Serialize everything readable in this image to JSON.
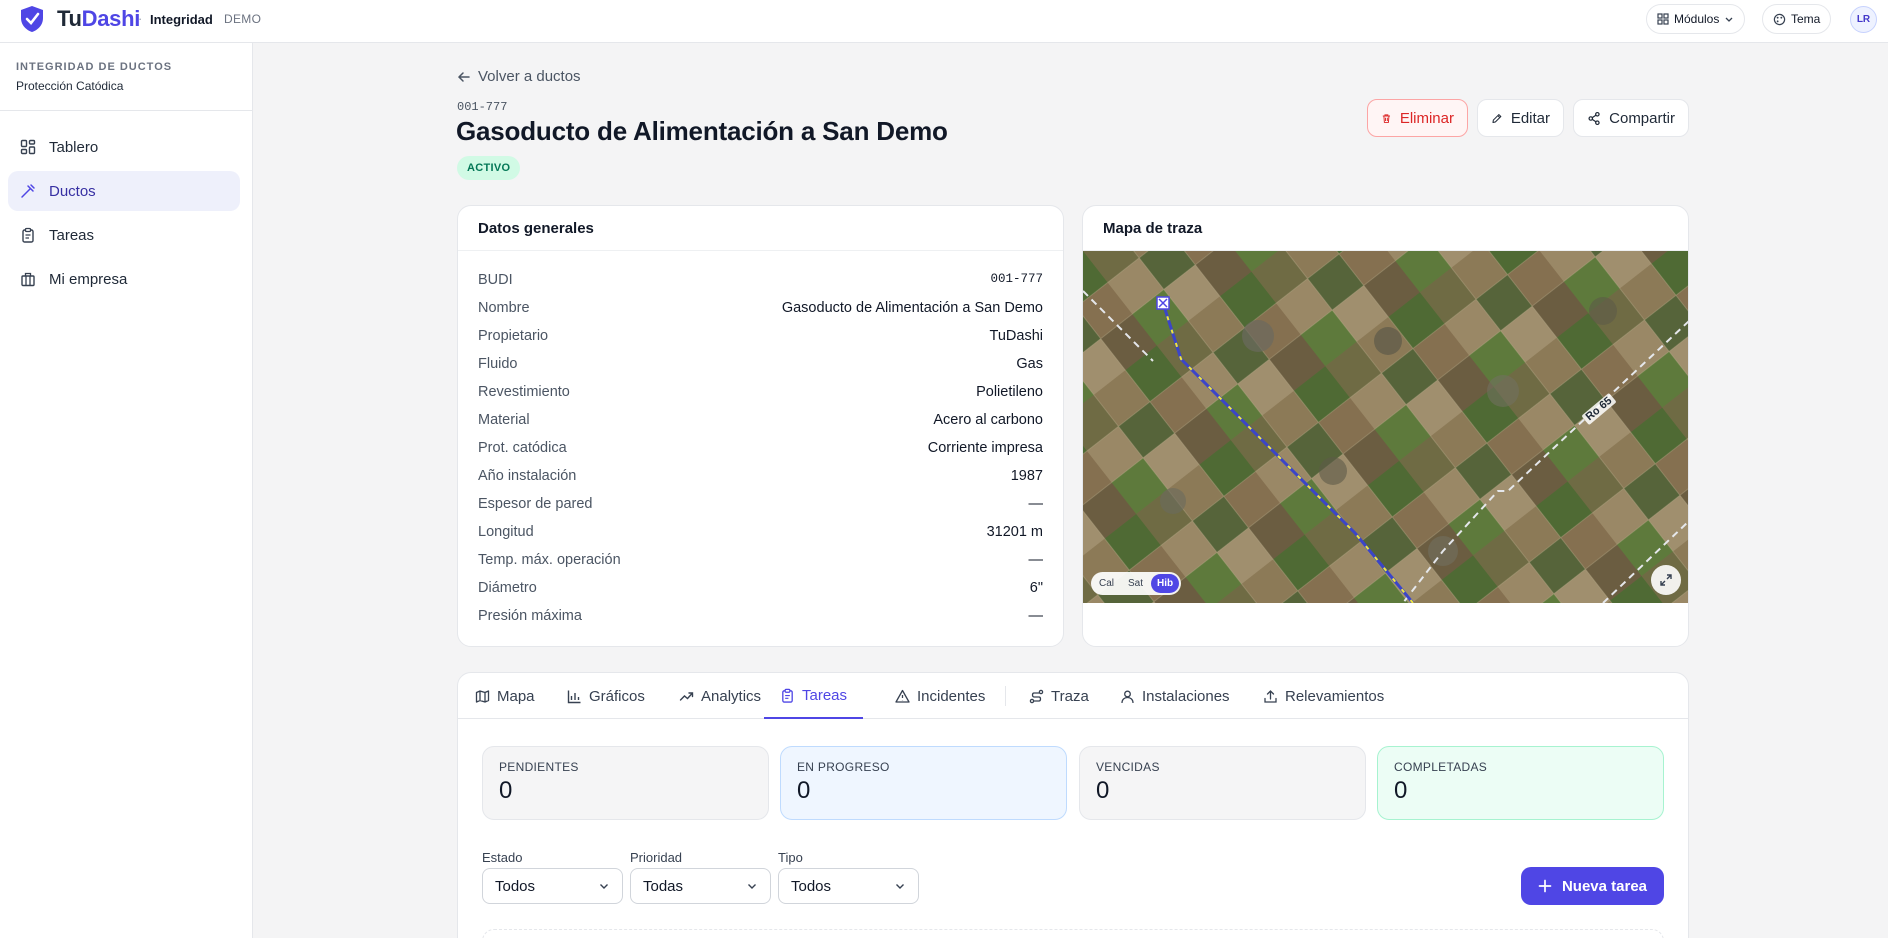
{
  "app": {
    "brand_tu": "Tu",
    "brand_dashi": "Dashi",
    "separator": "·",
    "module": "Integridad",
    "env": "DEMO",
    "modules_label": "Módulos",
    "theme_label": "Tema",
    "avatar_initials": "LR"
  },
  "sidebar": {
    "section_title": "INTEGRIDAD DE DUCTOS",
    "section_subtitle": "Protección Catódica",
    "items": [
      {
        "label": "Tablero",
        "icon": "dashboard-icon",
        "active": false
      },
      {
        "label": "Ductos",
        "icon": "pipe-icon",
        "active": true
      },
      {
        "label": "Tareas",
        "icon": "clipboard-icon",
        "active": false
      },
      {
        "label": "Mi empresa",
        "icon": "building-icon",
        "active": false
      }
    ]
  },
  "page": {
    "back_label": "Volver a ductos",
    "code": "001-777",
    "title": "Gasoducto de Alimentación a San Demo",
    "status": "ACTIVO",
    "actions": {
      "delete": "Eliminar",
      "edit": "Editar",
      "share": "Compartir"
    }
  },
  "general": {
    "title": "Datos generales",
    "rows": [
      {
        "key": "BUDI",
        "value": "001-777"
      },
      {
        "key": "Nombre",
        "value": "Gasoducto de Alimentación a San Demo"
      },
      {
        "key": "Propietario",
        "value": "TuDashi"
      },
      {
        "key": "Fluido",
        "value": "Gas"
      },
      {
        "key": "Revestimiento",
        "value": "Polietileno"
      },
      {
        "key": "Material",
        "value": "Acero al carbono"
      },
      {
        "key": "Prot. catódica",
        "value": "Corriente impresa"
      },
      {
        "key": "Año instalación",
        "value": "1987"
      },
      {
        "key": "Espesor de pared",
        "value": "—"
      },
      {
        "key": "Longitud",
        "value": "31201 m"
      },
      {
        "key": "Temp. máx. operación",
        "value": "—"
      },
      {
        "key": "Diámetro",
        "value": "6\""
      },
      {
        "key": "Presión máxima",
        "value": "—"
      }
    ]
  },
  "map": {
    "title": "Mapa de traza",
    "route_label": "Ro 65",
    "layers": [
      "Cal",
      "Sat",
      "Hib"
    ],
    "active_layer": "Hib",
    "colors": {
      "route": "#3b45c9",
      "route_dash": "#f1e83b",
      "road": "#e5e7eb"
    }
  },
  "tabs": {
    "items": [
      {
        "label": "Mapa",
        "icon": "map-icon"
      },
      {
        "label": "Gráficos",
        "icon": "bar-chart-icon"
      },
      {
        "label": "Analytics",
        "icon": "trend-icon"
      },
      {
        "label": "Tareas",
        "icon": "clipboard-icon"
      },
      {
        "label": "Incidentes",
        "icon": "alert-triangle-icon"
      },
      {
        "label": "Traza",
        "icon": "route-icon"
      },
      {
        "label": "Instalaciones",
        "icon": "install-icon"
      },
      {
        "label": "Relevamientos",
        "icon": "upload-icon"
      }
    ],
    "active": "Tareas"
  },
  "tasks": {
    "stats": [
      {
        "label": "PENDIENTES",
        "value": "0"
      },
      {
        "label": "EN PROGRESO",
        "value": "0"
      },
      {
        "label": "VENCIDAS",
        "value": "0"
      },
      {
        "label": "COMPLETADAS",
        "value": "0"
      }
    ],
    "filters": [
      {
        "label": "Estado",
        "value": "Todos"
      },
      {
        "label": "Prioridad",
        "value": "Todas"
      },
      {
        "label": "Tipo",
        "value": "Todos"
      }
    ],
    "new_task_label": "Nueva tarea"
  },
  "colors": {
    "accent": "#4f46e5",
    "danger": "#dc2626",
    "success_bg": "#d1fae5"
  }
}
